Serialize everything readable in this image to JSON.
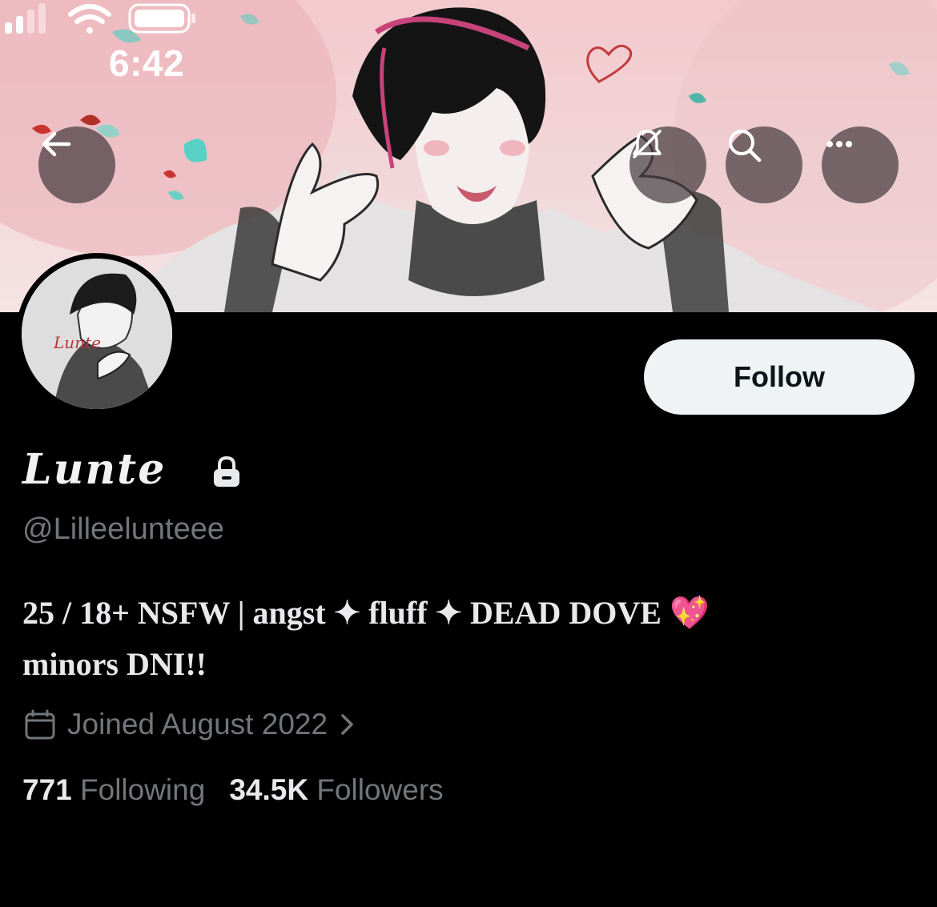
{
  "status_bar": {
    "time": "6:42"
  },
  "profile": {
    "display_name": "Lunte",
    "handle": "@Lilleelunteee",
    "bio_line1": "25 / 18+ NSFW | angst ✦ fluff ✦ DEAD DOVE",
    "bio_emoji": "💖",
    "bio_line2": "minors DNI!!",
    "joined": "Joined August 2022",
    "following_count": "771",
    "following_label": "Following",
    "followers_count": "34.5K",
    "followers_label": "Followers",
    "locked": true
  },
  "actions": {
    "follow_label": "Follow"
  },
  "icons": {
    "back": "back-arrow-icon",
    "subscribe": "notifications-off-icon",
    "search": "search-icon",
    "more": "more-icon",
    "lock": "lock-icon",
    "calendar": "calendar-icon",
    "chevron": "chevron-right-icon"
  },
  "colors": {
    "background": "#000000",
    "follow_button": "#eff3f4",
    "secondary_text": "#71767b",
    "banner_ribbon": "#c7437a"
  }
}
